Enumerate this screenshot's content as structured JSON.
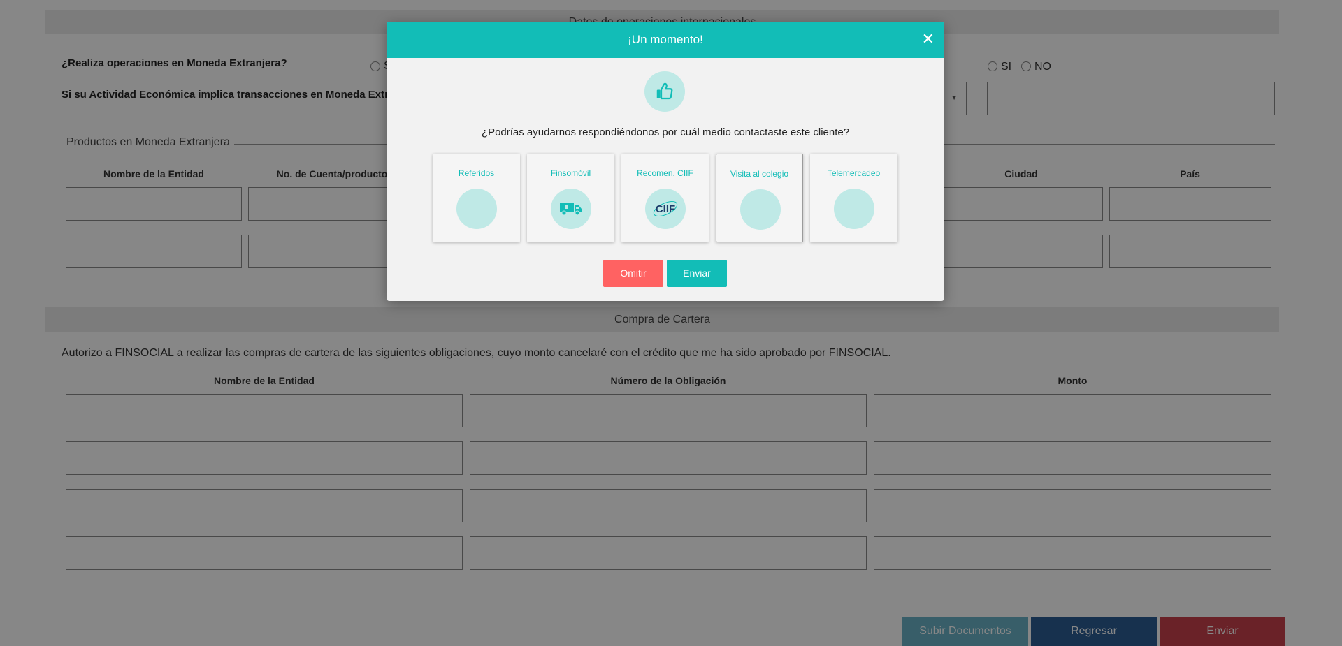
{
  "form": {
    "top_section_title": "Datos de operaciones internacionales",
    "q_foreign_ops": "¿Realiza operaciones en Moneda Extranjera?",
    "q_foreign_ops_yes": "SI",
    "q_activity": "Si su Actividad Económica implica transacciones en Moneda Extranjera",
    "right_yes": "SI",
    "right_no": "NO",
    "products_legend": "Productos en Moneda Extranjera",
    "products_columns": [
      "Nombre de la Entidad",
      "No. de Cuenta/producto",
      "Ciudad",
      "País"
    ],
    "purchase_section_title": "Compra de Cartera",
    "authorization_text": "Autorizo a FINSOCIAL a realizar las compras de cartera de las siguientes obligaciones, cuyo monto cancelaré con el crédito que me ha sido aprobado por FINSOCIAL.",
    "purchase_columns": [
      "Nombre de la Entidad",
      "Número de la Obligación",
      "Monto"
    ],
    "buttons": {
      "upload": "Subir Documentos",
      "back": "Regresar",
      "send": "Enviar"
    }
  },
  "modal": {
    "title": "¡Un momento!",
    "close_symbol": "✕",
    "question": "¿Podrías ayudarnos respondiéndonos por cuál medio contactaste este cliente?",
    "options": [
      {
        "label": "Referidos",
        "icon": "blank-icon",
        "selected": false
      },
      {
        "label": "Finsomóvil",
        "icon": "van-icon",
        "selected": false
      },
      {
        "label": "Recomen. CIIF",
        "icon": "ciif-logo",
        "selected": false
      },
      {
        "label": "Visita al colegio",
        "icon": "blank-icon",
        "selected": true
      },
      {
        "label": "Telemercadeo",
        "icon": "blank-icon",
        "selected": false
      }
    ],
    "logo_text": "CIIF",
    "omit_label": "Omitir",
    "send_label": "Enviar",
    "accent_color": "#12bdb7",
    "omit_color": "#ff6262"
  },
  "colors": {
    "upload_button": "#6ab2c6",
    "back_button": "#2d5d94",
    "send_button": "#c9404c"
  }
}
